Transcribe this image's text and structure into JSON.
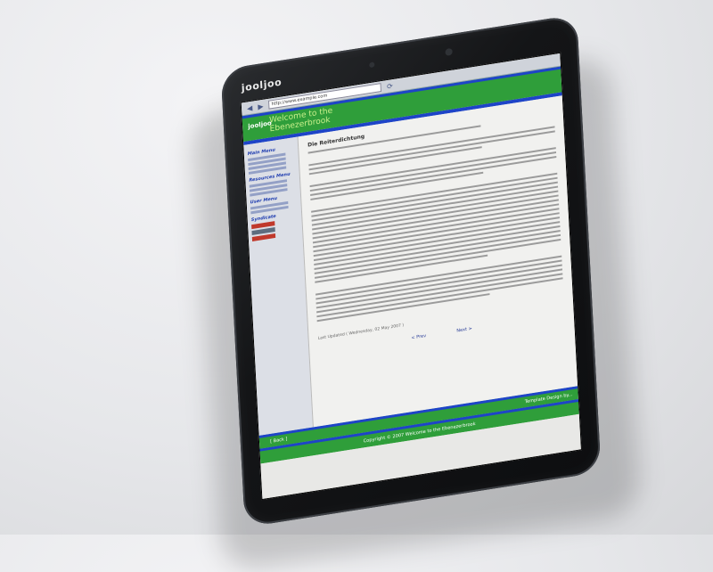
{
  "device": {
    "brand": "jooljoo"
  },
  "browser": {
    "url": "http://www.example.com"
  },
  "site": {
    "logo": "jooljoo",
    "title": "Welcome to the Ebenezerbrook",
    "sidebar": {
      "menus": [
        "Main Menu",
        "Resources Menu",
        "User Menu",
        "Syndicate"
      ]
    },
    "article": {
      "title": "Die Reiterdichtung",
      "last_updated": "Last Updated ( Wednesday, 02 May 2007 )",
      "prev": "< Prev",
      "next": "Next >"
    },
    "back": "[ Back ]",
    "footer_note": "Template Design by...",
    "copyright": "Copyright © 2007 Welcome to the Ebenezerbrook"
  }
}
